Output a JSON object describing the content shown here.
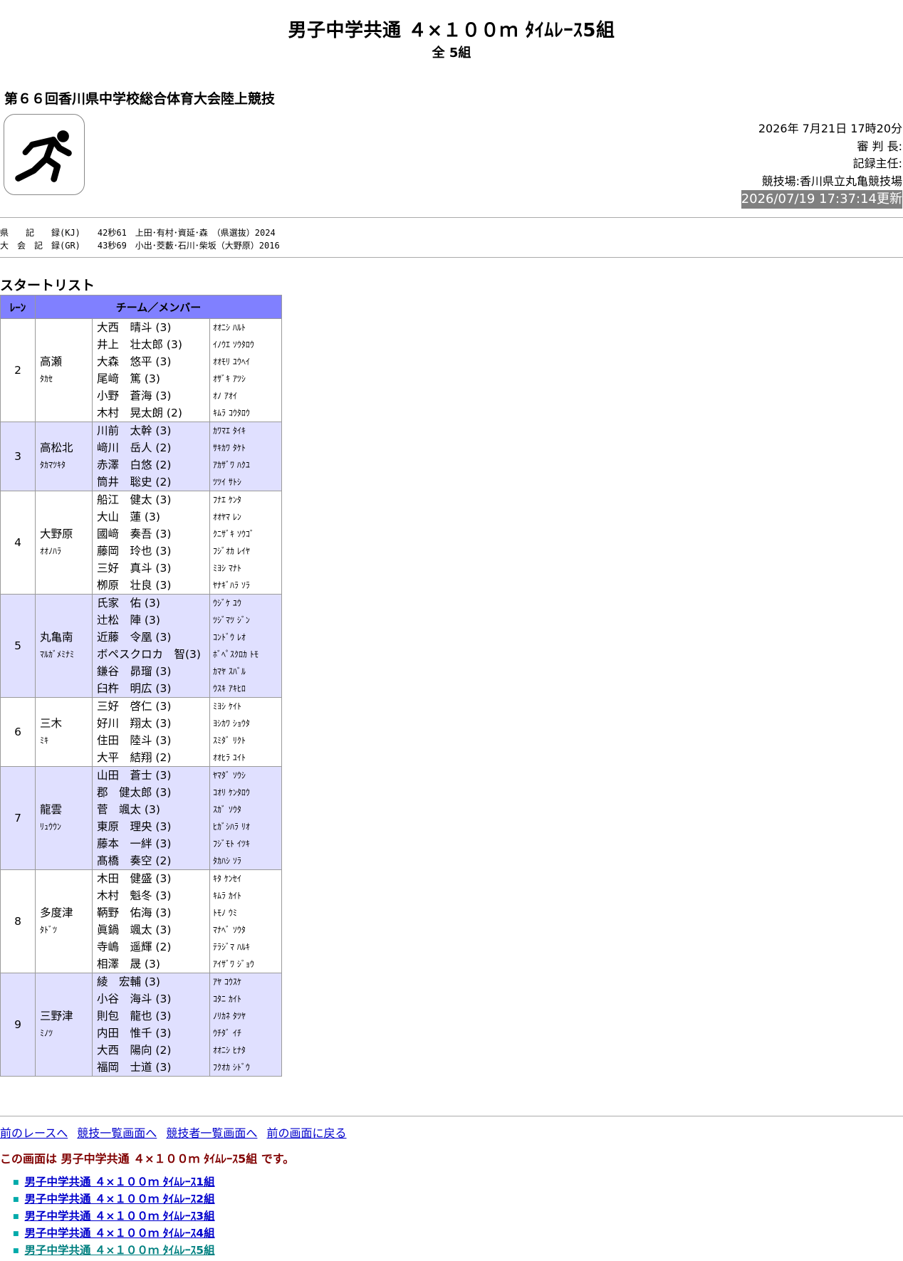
{
  "header": {
    "title": "男子中学共通 ４×１００ｍ ﾀｲﾑﾚｰｽ5組",
    "subtitle": "全 5組",
    "meet": "第６６回香川県中学校総合体育大会陸上競技"
  },
  "info": {
    "datetime": "2026年 7月21日 17時20分",
    "referee": "審 判 長:",
    "recorder": "記録主任:",
    "venue": "競技場:香川県立丸亀競技場",
    "updated": "2026/07/19 17:37:14更新"
  },
  "records": {
    "kj": "県　　記　　録(KJ)　　42秒61　上田･有村･資延･森　（県選抜）2024",
    "gr": "大　会　記　録(GR)　　43秒69　小出･茭藪･石川･柴坂（大野原）2016"
  },
  "startlist": {
    "heading": "スタートリスト",
    "col_lane": "ﾚｰﾝ",
    "col_team": "チーム／メンバー",
    "rows": [
      {
        "lane": "2",
        "team": "高瀬",
        "team_kana": "ﾀｶｾ",
        "members": [
          "大西　晴斗 (3)",
          "井上　壮太郎 (3)",
          "大森　悠平 (3)",
          "尾﨑　篤 (3)",
          "小野　蒼海 (3)",
          "木村　晃太朗 (2)"
        ],
        "kanas": [
          "ｵｵﾆｼ ﾊﾙﾄ",
          "ｲﾉｳｴ ｿｳﾀﾛｳ",
          "ｵｵﾓﾘ ﾕｳﾍｲ",
          "ｵｻﾞｷ ｱﾂｼ",
          "ｵﾉ ｱｵｲ",
          "ｷﾑﾗ ｺｳﾀﾛｳ"
        ]
      },
      {
        "lane": "3",
        "team": "高松北",
        "team_kana": "ﾀｶﾏﾂｷﾀ",
        "members": [
          "川前　太幹 (3)",
          "﨑川　岳人 (2)",
          "赤澤　白悠 (2)",
          "筒井　聡史 (2)"
        ],
        "kanas": [
          "ｶﾜﾏｴ ﾀｲｷ",
          "ｻｷｶﾜ ﾀｹﾄ",
          "ｱｶｻﾞﾜ ﾊｸﾕ",
          "ﾂﾂｲ ｻﾄｼ"
        ]
      },
      {
        "lane": "4",
        "team": "大野原",
        "team_kana": "ｵｵﾉﾊﾗ",
        "members": [
          "船江　健太 (3)",
          "大山　蓮 (3)",
          "國﨑　奏吾 (3)",
          "藤岡　玲也 (3)",
          "三好　真斗 (3)",
          "栁原　壮良 (3)"
        ],
        "kanas": [
          "ﾌﾅｴ ｹﾝﾀ",
          "ｵｵﾔﾏ ﾚﾝ",
          "ｸﾆｻﾞｷ ｿｳｺﾞ",
          "ﾌｼﾞｵｶ ﾚｲﾔ",
          "ﾐﾖｼ ﾏﾅﾄ",
          "ﾔﾅｷﾞﾊﾗ ｿﾗ"
        ]
      },
      {
        "lane": "5",
        "team": "丸亀南",
        "team_kana": "ﾏﾙｶﾞﾒﾐﾅﾐ",
        "members": [
          "氏家　佑 (3)",
          "辻松　陣 (3)",
          "近藤　令凰 (3)",
          "ボペスクロカ　智(3)",
          "鎌谷　昴瑠 (3)",
          "臼杵　明広 (3)"
        ],
        "kanas": [
          "ｳｼﾞｹ ﾕｳ",
          "ﾂｼﾞﾏﾂ ｼﾞﾝ",
          "ｺﾝﾄﾞｳ ﾚｵ",
          "ﾎﾞﾍﾟｽｸﾛｶ ﾄﾓ",
          "ｶﾏﾔ ｽﾊﾞﾙ",
          "ｳｽｷ ｱｷﾋﾛ"
        ]
      },
      {
        "lane": "6",
        "team": "三木",
        "team_kana": "ﾐｷ",
        "members": [
          "三好　啓仁 (3)",
          "好川　翔太 (3)",
          "住田　陸斗 (3)",
          "大平　結翔 (2)"
        ],
        "kanas": [
          "ﾐﾖｼ ｹｲﾄ",
          "ﾖｼｶﾜ ｼｮｳﾀ",
          "ｽﾐﾀﾞ ﾘｸﾄ",
          "ｵｵﾋﾗ ﾕｲﾄ"
        ]
      },
      {
        "lane": "7",
        "team": "龍雲",
        "team_kana": "ﾘｭｳｳﾝ",
        "members": [
          "山田　蒼士 (3)",
          "郡　健太郎 (3)",
          "菅　颯太 (3)",
          "東原　理央 (3)",
          "藤本　一絆 (3)",
          "髙橋　奏空 (2)"
        ],
        "kanas": [
          "ﾔﾏﾀﾞ ｿｳｼ",
          "ｺｵﾘ ｹﾝﾀﾛｳ",
          "ｽｶﾞ ｿｳﾀ",
          "ﾋｶﾞｼﾊﾗ ﾘｵ",
          "ﾌｼﾞﾓﾄ ｲﾂｷ",
          "ﾀｶﾊｼ ｿﾗ"
        ]
      },
      {
        "lane": "8",
        "team": "多度津",
        "team_kana": "ﾀﾄﾞﾂ",
        "members": [
          "木田　健盛 (3)",
          "木村　魁冬 (3)",
          "鞆野　佑海 (3)",
          "眞鍋　颯太 (3)",
          "寺嶋　遥輝 (2)",
          "相澤　晟 (3)"
        ],
        "kanas": [
          "ｷﾀ ｹﾝｾｲ",
          "ｷﾑﾗ ｶｲﾄ",
          "ﾄﾓﾉ ｳﾐ",
          "ﾏﾅﾍﾞ ｿｳﾀ",
          "ﾃﾗｼﾞﾏ ﾊﾙｷ",
          "ｱｲｻﾞﾜ ｼﾞｮｳ"
        ]
      },
      {
        "lane": "9",
        "team": "三野津",
        "team_kana": "ﾐﾉﾂ",
        "members": [
          "綾　宏輔 (3)",
          "小谷　海斗 (3)",
          "則包　龍也 (3)",
          "内田　惟千 (3)",
          "大西　陽向 (2)",
          "福岡　士道 (3)"
        ],
        "kanas": [
          "ｱﾔ ｺｳｽｹ",
          "ｺﾀﾆ ｶｲﾄ",
          "ﾉﾘｶﾈ ﾀﾂﾔ",
          "ｳﾁﾀﾞ ｲﾁ",
          "ｵｵﾆｼ ﾋﾅﾀ",
          "ﾌｸｵｶ ｼﾄﾞｳ"
        ]
      }
    ]
  },
  "nav": {
    "prev_race": "前のレースへ",
    "event_list": "競技一覧画面へ",
    "athlete_list": "競技者一覧画面へ",
    "back": "前の画面に戻る"
  },
  "current_note": "この画面は 男子中学共通 ４×１００ｍ ﾀｲﾑﾚｰｽ5組 です。",
  "race_links": [
    "男子中学共通 ４×１００ｍ ﾀｲﾑﾚｰｽ1組",
    "男子中学共通 ４×１００ｍ ﾀｲﾑﾚｰｽ2組",
    "男子中学共通 ４×１００ｍ ﾀｲﾑﾚｰｽ3組",
    "男子中学共通 ４×１００ｍ ﾀｲﾑﾚｰｽ4組",
    "男子中学共通 ４×１００ｍ ﾀｲﾑﾚｰｽ5組"
  ],
  "icons": {
    "logo": "sprinter-icon"
  },
  "colors": {
    "header_bg": "#8080ff",
    "alt_row_bg": "#e0e0ff",
    "link": "#0000cc",
    "note": "#800000",
    "updated_bg": "#808080"
  }
}
